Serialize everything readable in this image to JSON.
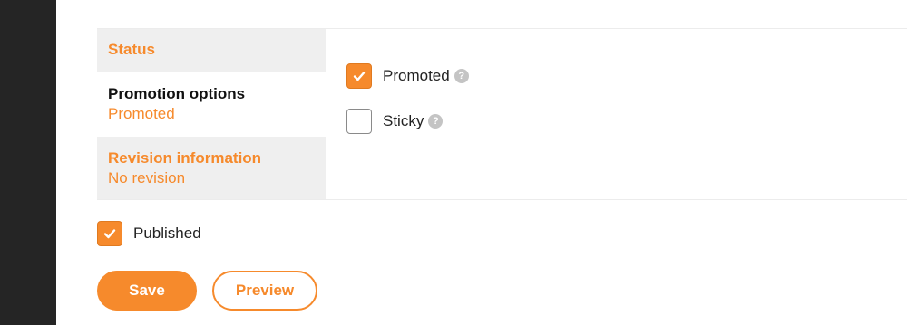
{
  "vertical_tabs": [
    {
      "title": "Status",
      "summary": ""
    },
    {
      "title": "Promotion options",
      "summary": "Promoted"
    },
    {
      "title": "Revision information",
      "summary": "No revision"
    }
  ],
  "promotion_pane": {
    "promoted": {
      "label": "Promoted",
      "checked": true
    },
    "sticky": {
      "label": "Sticky",
      "checked": false
    },
    "help_glyph": "?"
  },
  "published": {
    "label": "Published",
    "checked": true
  },
  "actions": {
    "save_label": "Save",
    "preview_label": "Preview"
  },
  "colors": {
    "accent": "#f68a2c",
    "sidebar": "#252525",
    "tab_bg": "#efefef"
  }
}
